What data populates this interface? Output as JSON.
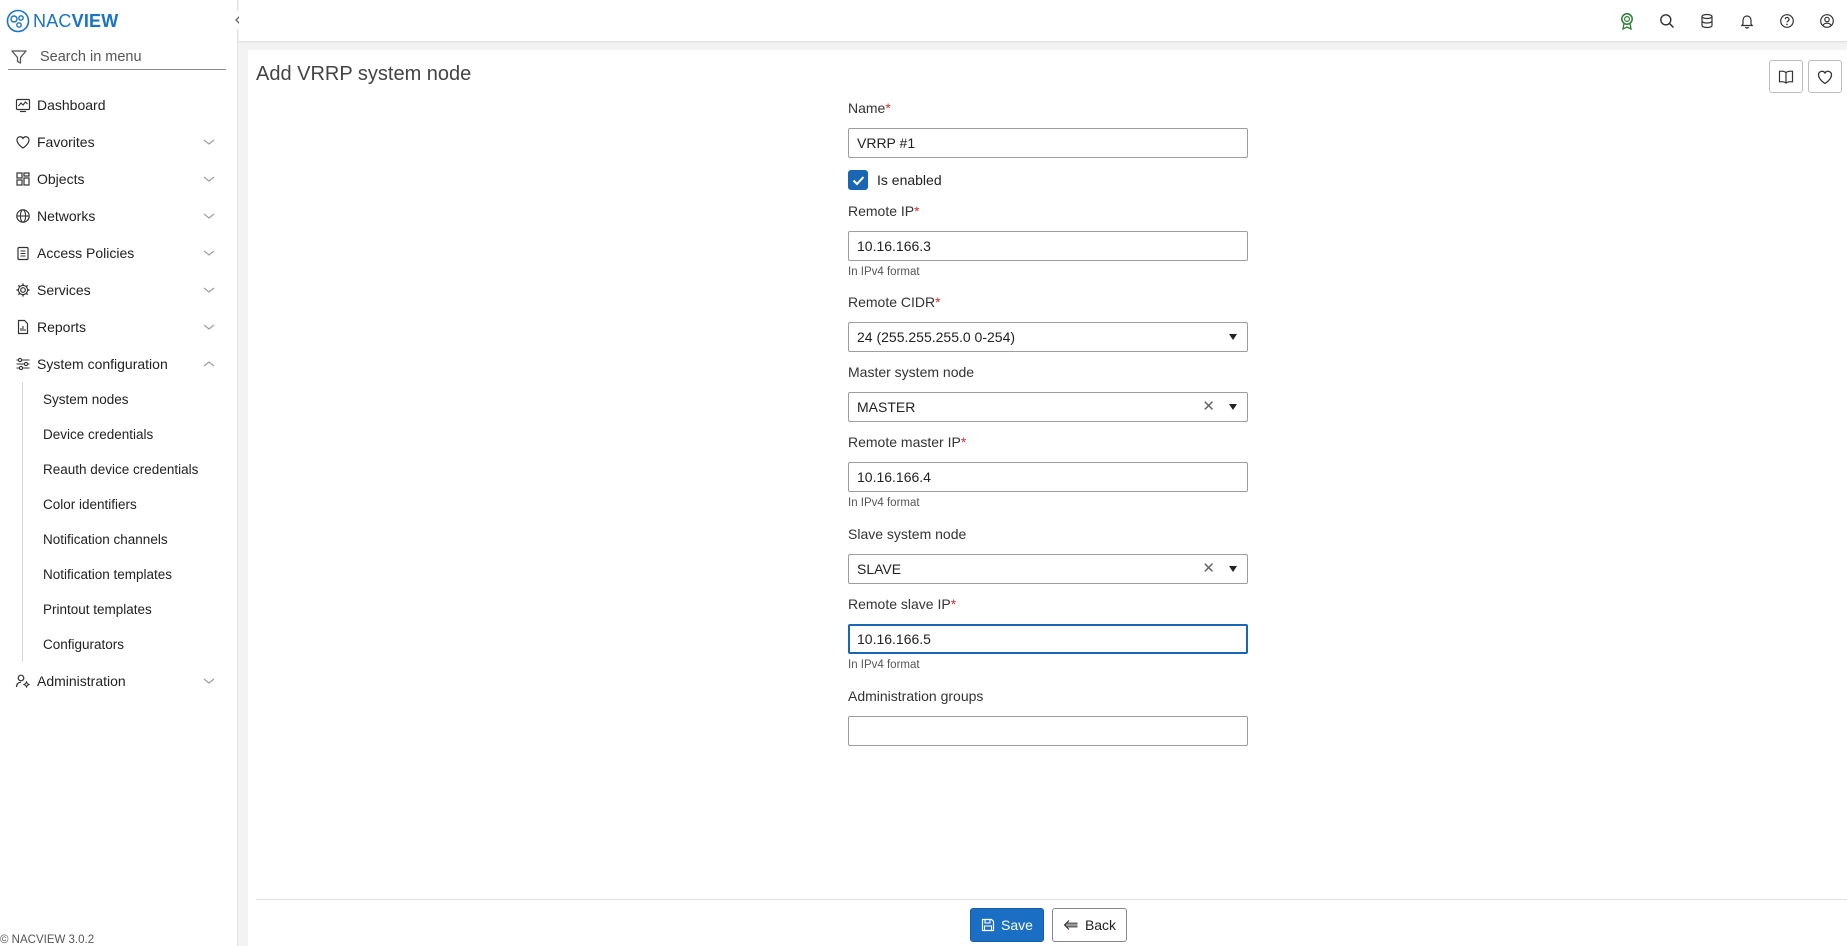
{
  "app": {
    "logo_prefix": "NAC",
    "logo_suffix": "VIEW",
    "version": "© NACVIEW 3.0.2"
  },
  "sidebar": {
    "search_placeholder": "Search in menu",
    "items": [
      {
        "label": "Dashboard",
        "icon": "dashboard-icon"
      },
      {
        "label": "Favorites",
        "icon": "heart-icon"
      },
      {
        "label": "Objects",
        "icon": "objects-icon"
      },
      {
        "label": "Networks",
        "icon": "globe-icon"
      },
      {
        "label": "Access Policies",
        "icon": "clipboard-icon"
      },
      {
        "label": "Services",
        "icon": "gear-icon"
      },
      {
        "label": "Reports",
        "icon": "report-icon"
      },
      {
        "label": "System configuration",
        "icon": "sliders-icon"
      },
      {
        "label": "Administration",
        "icon": "admin-icon"
      }
    ],
    "submenu": [
      "System nodes",
      "Device credentials",
      "Reauth device credentials",
      "Color identifiers",
      "Notification channels",
      "Notification templates",
      "Printout templates",
      "Configurators"
    ]
  },
  "topbar": {
    "icons": [
      "license-badge-icon",
      "search-icon",
      "database-icon",
      "bell-icon",
      "help-icon",
      "user-icon"
    ],
    "accent": "#2e7d32"
  },
  "page": {
    "title": "Add VRRP system node"
  },
  "form": {
    "name_label": "Name",
    "name_value": "VRRP #1",
    "enabled_label": "Is enabled",
    "enabled_checked": true,
    "remote_ip_label": "Remote IP",
    "remote_ip_value": "10.16.166.3",
    "ipv4_hint": "In IPv4 format",
    "remote_cidr_label": "Remote CIDR",
    "remote_cidr_value": "24 (255.255.255.0 0-254)",
    "master_label": "Master system node",
    "master_value": "MASTER",
    "remote_master_ip_label": "Remote master IP",
    "remote_master_ip_value": "10.16.166.4",
    "slave_label": "Slave system node",
    "slave_value": "SLAVE",
    "remote_slave_ip_label": "Remote slave IP",
    "remote_slave_ip_value": "10.16.166.5",
    "admin_groups_label": "Administration groups",
    "admin_groups_value": "",
    "required_mark": "*",
    "clear_glyph": "✕"
  },
  "actions": {
    "save_label": "Save",
    "back_label": "Back"
  },
  "colors": {
    "primary": "#1a6fc4",
    "required": "#d32f2f"
  }
}
